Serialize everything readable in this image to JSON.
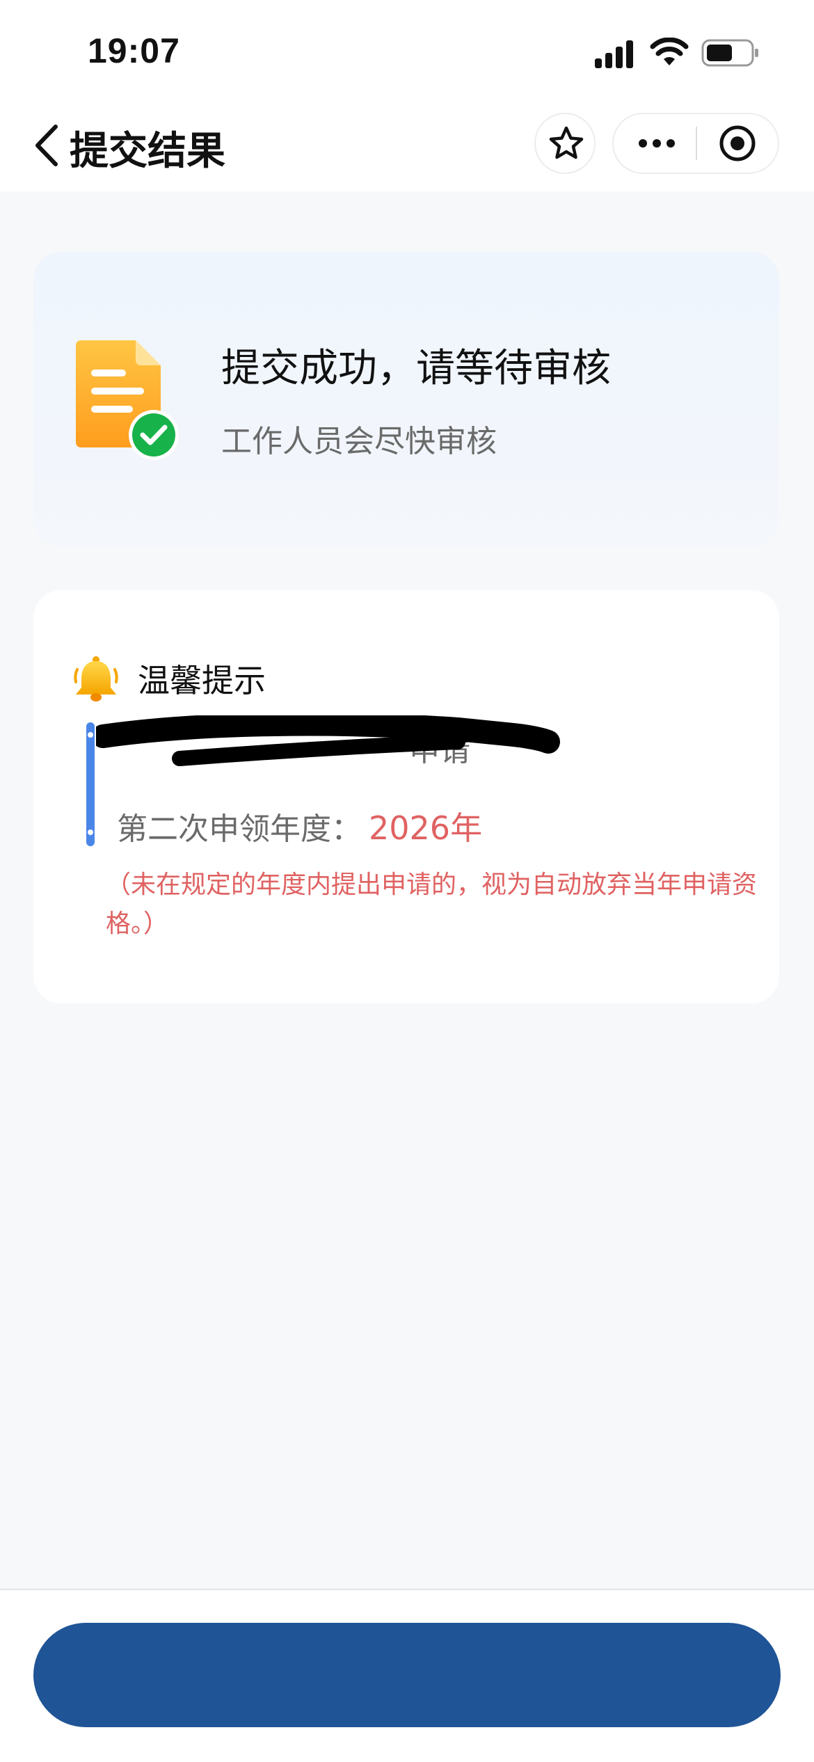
{
  "status_bar": {
    "time": "19:07",
    "signal_icon": "cellular-signal-icon",
    "wifi_icon": "wifi-icon",
    "battery_icon": "battery-icon"
  },
  "nav": {
    "title": "提交结果",
    "back_icon": "chevron-left-icon",
    "star_icon": "star-icon",
    "more_icon": "more-dots-icon",
    "close_icon": "target-circle-icon"
  },
  "success": {
    "title": "提交成功，请等待审核",
    "subtitle": "工作人员会尽快审核",
    "icon": "document-check-icon"
  },
  "tips": {
    "icon": "bell-icon",
    "title": "温馨提示",
    "first_line": "申请",
    "second_label": "第二次申领年度：",
    "second_year": "2026年",
    "note": "（未在规定的年度内提出申请的，视为自动放弃当年申请资格。）"
  },
  "bottom": {
    "button_label": ""
  },
  "colors": {
    "accent_blue": "#1f5496",
    "timeline_blue": "#4a86e8",
    "warning_red": "#e06262",
    "page_bg": "#f7f8fa"
  }
}
